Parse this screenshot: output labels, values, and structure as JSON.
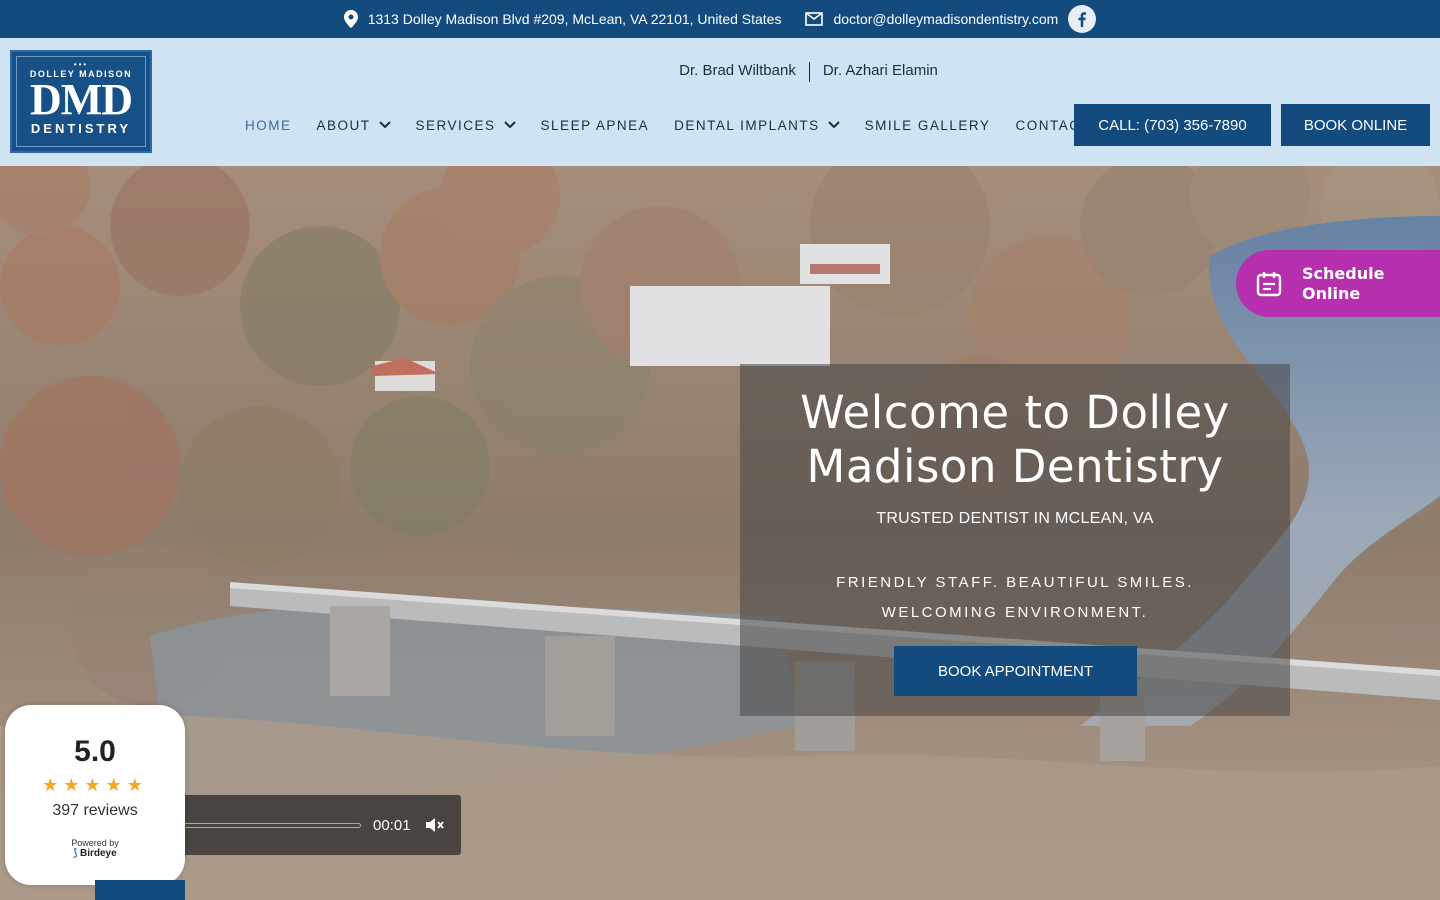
{
  "topbar": {
    "address": "1313 Dolley Madison Blvd #209, McLean, VA 22101, United States",
    "email": "doctor@dolleymadisondentistry.com",
    "facebook_icon": "facebook-icon"
  },
  "logo": {
    "top": "DOLLEY MADISON",
    "big": "DMD",
    "bottom": "DENTISTRY"
  },
  "doctors": [
    "Dr. Brad Wiltbank",
    "Dr. Azhari Elamin"
  ],
  "nav": {
    "items": [
      {
        "label": "HOME",
        "active": true
      },
      {
        "label": "ABOUT",
        "dropdown": true
      },
      {
        "label": "SERVICES",
        "dropdown": true
      },
      {
        "label": "SLEEP APNEA"
      },
      {
        "label": "DENTAL IMPLANTS",
        "dropdown": true
      },
      {
        "label": "SMILE GALLERY"
      },
      {
        "label": "CONTACT"
      }
    ],
    "call_label": "CALL: (703) 356-7890",
    "book_label": "BOOK ONLINE"
  },
  "hero": {
    "title": "Welcome to Dolley Madison Dentistry",
    "subtitle": "TRUSTED DENTIST IN MCLEAN, VA",
    "tagline_1": "FRIENDLY STAFF. BEAUTIFUL SMILES.",
    "tagline_2": "WELCOMING ENVIRONMENT.",
    "button": "BOOK APPOINTMENT"
  },
  "schedule": {
    "line1": "Schedule",
    "line2": "Online"
  },
  "video": {
    "time": "00:01"
  },
  "reviews": {
    "score": "5.0",
    "stars": "★★★★★",
    "count": "397 reviews",
    "powered": "Powered by",
    "brand": "Birdeye"
  },
  "colors": {
    "primary": "#134b7e",
    "header_bg": "#cfe3f3",
    "schedule": "#b52fae",
    "stars": "#f5a623"
  }
}
